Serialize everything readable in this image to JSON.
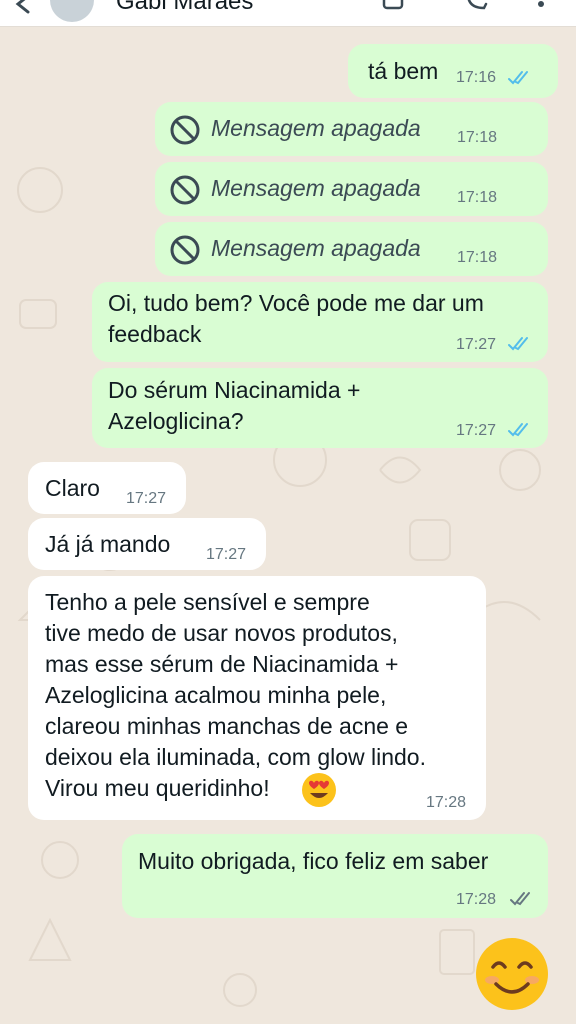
{
  "header": {
    "contact_name": "Gabi Marães",
    "icons": [
      "back-arrow-icon",
      "avatar",
      "video-call-icon",
      "phone-icon",
      "menu-icon"
    ]
  },
  "colors": {
    "wallpaper": "#efe7dd",
    "outgoing_bubble": "#d9fdd3",
    "incoming_bubble": "#ffffff",
    "read_ticks": "#53bdeb",
    "unread_ticks": "#667781"
  },
  "messages": [
    {
      "dir": "out",
      "text": "tá bem",
      "time": "17:16",
      "status": "read"
    },
    {
      "dir": "out",
      "text": "Mensagem apagada",
      "time": "17:18",
      "deleted": true
    },
    {
      "dir": "out",
      "text": "Mensagem apagada",
      "time": "17:18",
      "deleted": true
    },
    {
      "dir": "out",
      "text": "Mensagem apagada",
      "time": "17:18",
      "deleted": true
    },
    {
      "dir": "out",
      "lines": [
        "Oi, tudo bem? Você pode me dar um",
        "feedback"
      ],
      "time": "17:27",
      "status": "read"
    },
    {
      "dir": "out",
      "lines": [
        "Do sérum Niacinamida +",
        "Azeloglicina?"
      ],
      "time": "17:27",
      "status": "read"
    },
    {
      "dir": "in",
      "text": "Claro",
      "time": "17:27"
    },
    {
      "dir": "in",
      "text": "Já já mando",
      "time": "17:27"
    },
    {
      "dir": "in",
      "lines": [
        "Tenho a pele sensível e sempre",
        "tive medo de usar novos produtos,",
        "mas esse sérum de Niacinamida +",
        "Azeloglicina acalmou minha pele,",
        "clareou minhas manchas de acne e",
        "deixou ela iluminada, com glow lindo.",
        "Virou meu queridinho!"
      ],
      "emoji": "heart-eyes-emoji",
      "time": "17:28"
    },
    {
      "dir": "out",
      "text": "Muito obrigada, fico feliz em saber",
      "time": "17:28",
      "status": "delivered"
    },
    {
      "dir": "out",
      "emoji": "smiling-face-emoji"
    }
  ]
}
